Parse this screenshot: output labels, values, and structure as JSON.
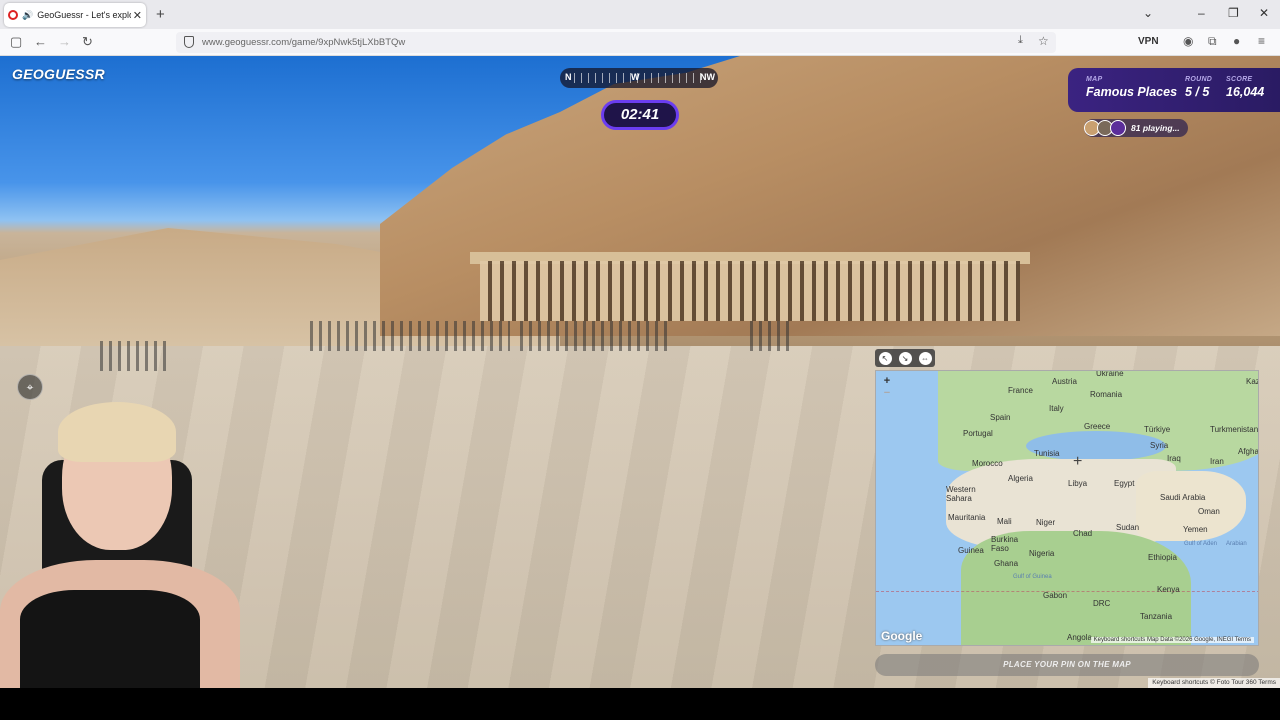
{
  "browser": {
    "tab_title": "GeoGuessr - Let's explore t",
    "url": "www.geoguessr.com/game/9xpNwk5tjLXbBTQw",
    "vpn_label": "VPN",
    "new_tab": "+"
  },
  "game": {
    "logo": "GEOGUESSR",
    "compass": {
      "left": "N",
      "center": "W",
      "right": "NW"
    },
    "timer": "02:41",
    "map_label": "MAP",
    "map_value": "Famous Places",
    "round_label": "ROUND",
    "round_value": "5 / 5",
    "score_label": "SCORE",
    "score_value": "16,044",
    "players_text": "81 playing...",
    "place_pin_button": "PLACE YOUR PIN ON THE MAP",
    "footer": "Keyboard shortcuts  © Foto Tour 360  Terms"
  },
  "minimap": {
    "labels": [
      "Ukraine",
      "Austria",
      "France",
      "Romania",
      "Kaz",
      "Spain",
      "Italy",
      "Portugal",
      "Greece",
      "Türkiye",
      "Turkmenistan",
      "Syria",
      "Tunisia",
      "Morocco",
      "Iraq",
      "Iran",
      "Afghan",
      "Algeria",
      "Libya",
      "Egypt",
      "Western Sahara",
      "Saudi Arabia",
      "Oman",
      "Mauritania",
      "Mali",
      "Niger",
      "Sudan",
      "Chad",
      "Yemen",
      "Burkina Faso",
      "Guinea",
      "Nigeria",
      "Ethiopia",
      "Ghana",
      "Gulf of Guinea",
      "Gulf of Aden",
      "Arabian",
      "Kenya",
      "Gabon",
      "DRC",
      "Tanzania",
      "Angola"
    ],
    "google": "Google",
    "footer": "Keyboard shortcuts  Map Data ©2026 Google, INEGI  Terms"
  }
}
